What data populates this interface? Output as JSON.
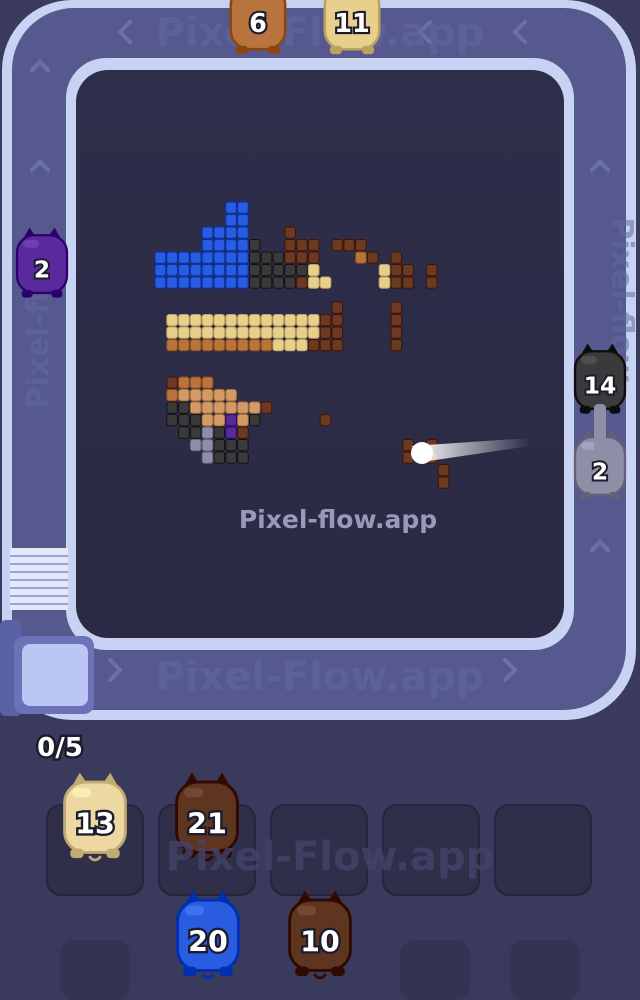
{
  "watermark": {
    "main": "Pixel-flow.app",
    "conveyor_bottom": "Pixel-Flow.app",
    "conveyor_top": "Pixel-Flow.app",
    "conveyor_right": "Pixel-flow",
    "conveyor_left": "Pixel-flo",
    "tray": "Pixel-Flow.app"
  },
  "queue_counter": {
    "current": 0,
    "capacity": 5,
    "text": "0/5"
  },
  "conveyor_pigs": [
    {
      "id": "top-left",
      "color_name": "orange-brown",
      "color": "#b8743c",
      "count": "6"
    },
    {
      "id": "top-right",
      "color_name": "cream",
      "color": "#e9cf8c",
      "count": "11"
    },
    {
      "id": "left",
      "color_name": "purple",
      "color": "#5a2a9c",
      "count": "2"
    },
    {
      "id": "right-top",
      "color_name": "black",
      "color": "#3a3a3a",
      "count": "14"
    },
    {
      "id": "right-bottom",
      "color_name": "gray",
      "color": "#8e8ea6",
      "count": "2"
    }
  ],
  "tray_slots": [
    {
      "slot": 1,
      "pig": {
        "color_name": "cream",
        "color": "#ecd8a0",
        "count": "13"
      }
    },
    {
      "slot": 2,
      "pig": {
        "color_name": "dark-brown",
        "color": "#5e3620",
        "count": "21"
      }
    },
    {
      "slot": 3,
      "pig": null
    },
    {
      "slot": 4,
      "pig": null
    },
    {
      "slot": 5,
      "pig": null
    }
  ],
  "queue_pigs": [
    {
      "color_name": "blue",
      "color": "#2a5ce0",
      "count": "20"
    },
    {
      "color_name": "dark-brown",
      "color": "#5e3620",
      "count": "10"
    }
  ],
  "colors": {
    "background": "#3a3a5c",
    "board": "#2c2c46",
    "track": "#5a5e96",
    "track_rail": "#c8d2f2",
    "blue": "#2a5ce0",
    "black": "#3a3a3a",
    "brown": "#6b3a22",
    "orange_brown": "#b8743c",
    "tan": "#d29a64",
    "cream": "#e9cf8c",
    "gray": "#8e8ea6",
    "purple": "#5a2a9c"
  },
  "pixel_art": {
    "palette": {
      "B": "#2a5ce0",
      "K": "#3a3a3a",
      "R": "#6b3a22",
      "O": "#b8743c",
      "T": "#d29a64",
      "C": "#e9cf8c",
      "G": "#8e8ea6",
      "P": "#5a2a9c"
    },
    "rows": [
      "......BB.....................",
      "......BB.....................",
      "....BBBB...R.................",
      "....BBBBK..RRR.RRR...........",
      "BBBBBBBBKKKRRR...OR.R........",
      "BBBBBBBBKKKKKC.....CRR.R.....",
      "BBBBBBBBKKKKRCC....CRR.R.....",
      ".............................",
      "...............R....R.........",
      ".CCCCCCCCCCCCCRR....R........",
      ".CCCCCCCCCCCCCRR....R........",
      ".OOOOOOOOOCCCRRR....R........",
      ".............................",
      ".............................",
      ".ROOO........................",
      ".OTTTTT......................",
      ".KKTTTTTTR...................",
      ".KKKTTPTK.....R..............",
      "..KKGKPR.....................",
      "...GGKKK.............R.R.....",
      "....GKKK.............R.R.....",
      "........................R....",
      "........................R...."
    ]
  }
}
